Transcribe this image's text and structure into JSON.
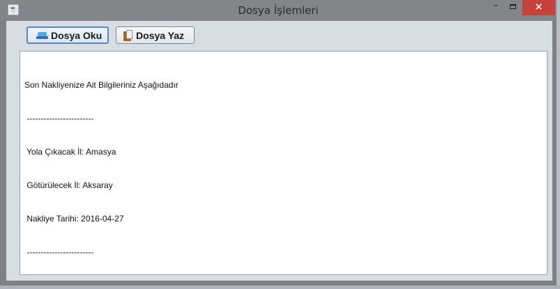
{
  "window": {
    "title": "Dosya İşlemleri",
    "icon": "java-icon",
    "controls": {
      "minimize": "–",
      "close": "✕"
    }
  },
  "toolbar": {
    "read_label": "Dosya Oku",
    "read_icon": "drive-icon",
    "write_label": "Dosya Yaz",
    "write_icon": "clipboard-icon"
  },
  "output": {
    "lines": [
      "Son Nakliyenize Ait Bilgileriniz Aşağıdadır",
      " ------------------------",
      " Yola Çıkacak İl: Amasya",
      " Götürülecek İl: Aksaray",
      " Nakliye Tarihi: 2016-04-27",
      " ------------------------"
    ]
  },
  "colors": {
    "titlebar": "#848589",
    "close_button": "#c6413a",
    "client_background": "#d8dde4",
    "active_button_border": "#5b87b8"
  }
}
